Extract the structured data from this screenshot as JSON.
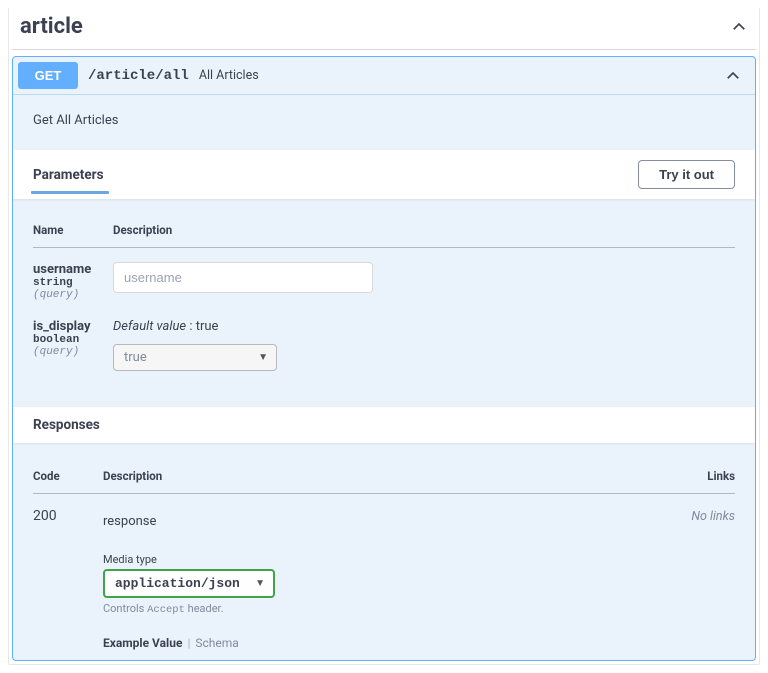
{
  "tag": {
    "name": "article"
  },
  "op": {
    "method": "GET",
    "path": "/article/all",
    "summary": "All Articles",
    "description": "Get All Articles"
  },
  "sections": {
    "parameters": "Parameters",
    "responses": "Responses"
  },
  "buttons": {
    "try": "Try it out"
  },
  "table": {
    "name": "Name",
    "description": "Description",
    "code": "Code",
    "links": "Links"
  },
  "params": [
    {
      "name": "username",
      "type": "string",
      "in": "(query)",
      "placeholder": "username"
    },
    {
      "name": "is_display",
      "type": "boolean",
      "in": "(query)",
      "default_label": "Default value",
      "default_value": "true",
      "selected": "true"
    }
  ],
  "responses": [
    {
      "code": "200",
      "description": "response",
      "links": "No links",
      "media_label": "Media type",
      "media_type": "application/json",
      "controls_prefix": "Controls ",
      "controls_mono": "Accept",
      "controls_suffix": " header.",
      "example_value": "Example Value",
      "schema": "Schema"
    }
  ]
}
